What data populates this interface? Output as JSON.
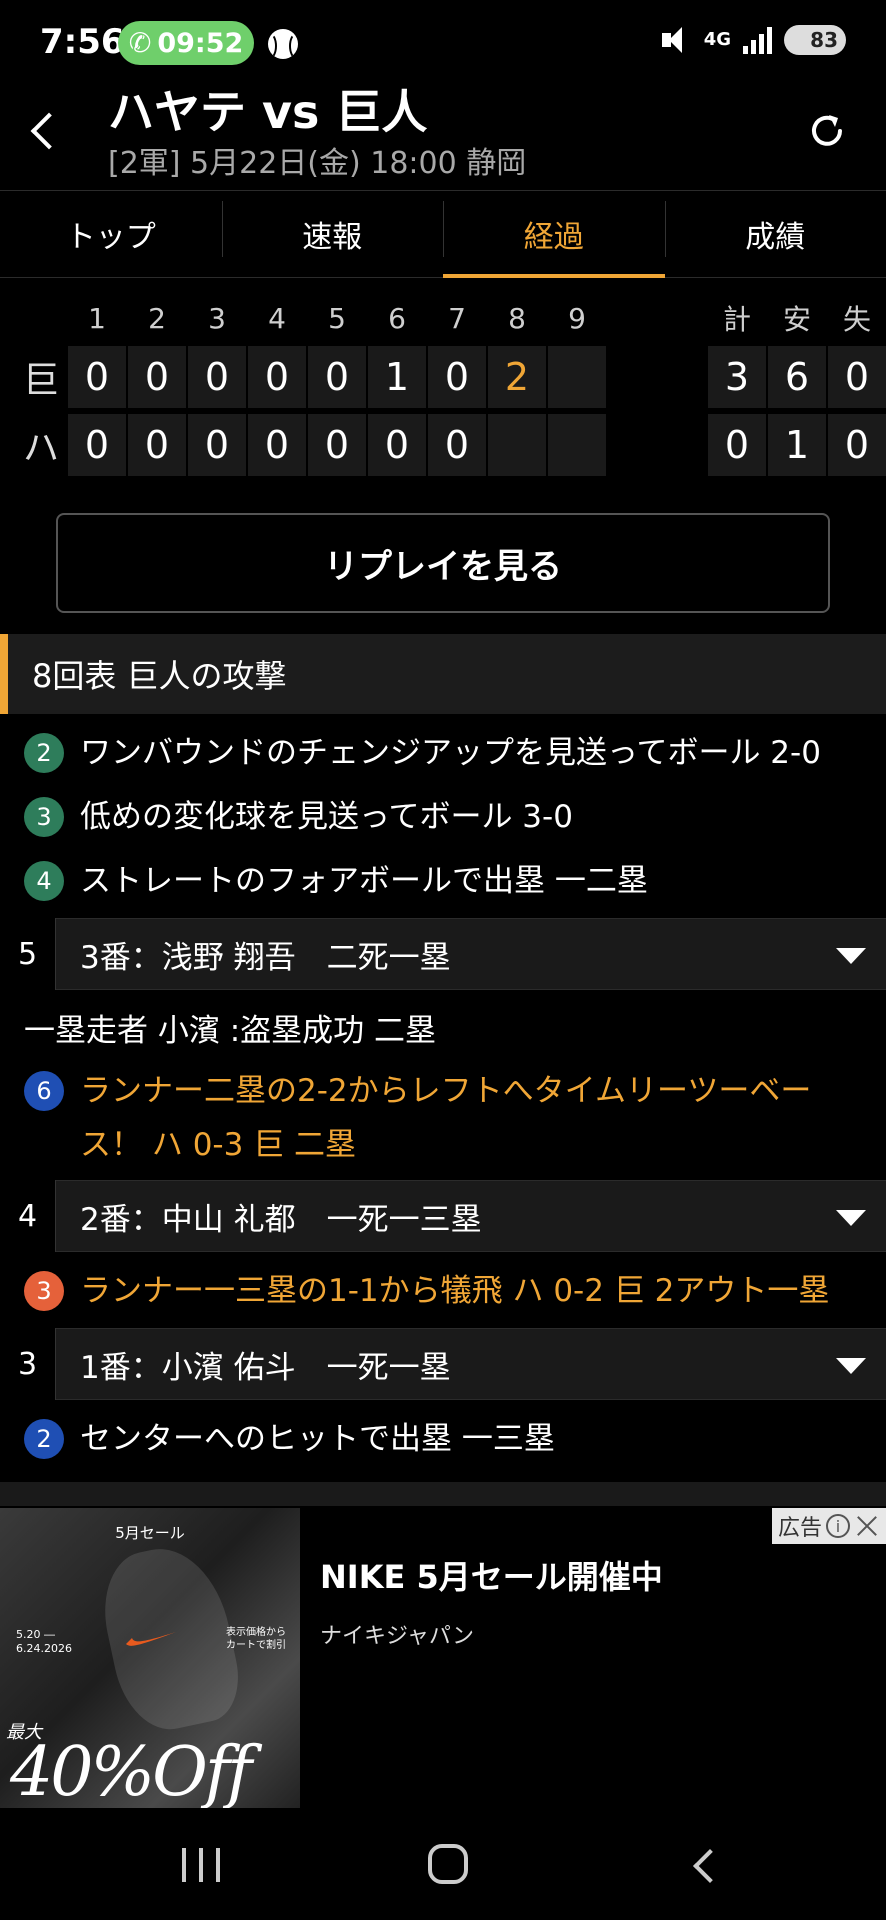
{
  "status_bar": {
    "time": "7:56",
    "call_time": "09:52",
    "network": "4G",
    "battery": "83"
  },
  "header": {
    "title": "ハヤテ vs 巨人",
    "subtitle": "[2軍] 5月22日(金) 18:00 静岡"
  },
  "tabs": [
    {
      "label": "トップ",
      "active": false
    },
    {
      "label": "速報",
      "active": false
    },
    {
      "label": "経過",
      "active": true
    },
    {
      "label": "成績",
      "active": false
    }
  ],
  "scoreboard": {
    "innings": [
      "1",
      "2",
      "3",
      "4",
      "5",
      "6",
      "7",
      "8",
      "9"
    ],
    "totals_headers": [
      "計",
      "安",
      "失"
    ],
    "teams": [
      {
        "name": "巨",
        "scores": [
          "0",
          "0",
          "0",
          "0",
          "0",
          "1",
          "0",
          "2",
          ""
        ],
        "totals": [
          "3",
          "6",
          "0"
        ]
      },
      {
        "name": "ハ",
        "scores": [
          "0",
          "0",
          "0",
          "0",
          "0",
          "0",
          "0",
          "",
          ""
        ],
        "totals": [
          "0",
          "1",
          "0"
        ]
      }
    ]
  },
  "replay_button": "リプレイを見る",
  "section": {
    "title": "8回表 巨人の攻撃"
  },
  "plays": {
    "p1": {
      "num": "2",
      "text": "ワンバウンドのチェンジアップを見送ってボール 2-0"
    },
    "p2": {
      "num": "3",
      "text": "低めの変化球を見送ってボール 3-0"
    },
    "p3": {
      "num": "4",
      "text": "ストレートのフォアボールで出塁 一二塁"
    },
    "batter5": {
      "order": "5",
      "label": "3番：浅野 翔吾　二死一塁"
    },
    "runner_note": "一塁走者 小濱 :盗塁成功 二塁",
    "p4": {
      "num": "6",
      "text": "ランナー二塁の2-2からレフトへタイムリーツーベース！ ハ 0-3 巨 二塁"
    },
    "batter4": {
      "order": "4",
      "label": "2番：中山 礼都　一死一三塁"
    },
    "p5": {
      "num": "3",
      "text": "ランナー一三塁の1-1から犠飛 ハ 0-2 巨 2アウト一塁"
    },
    "batter3": {
      "order": "3",
      "label": "1番：小濱 佑斗　一死一塁"
    },
    "p6": {
      "num": "2",
      "text": "センターへのヒットで出塁 一三塁"
    }
  },
  "ad": {
    "label": "広告",
    "title": "NIKE 5月セール開催中",
    "advertiser": "ナイキジャパン",
    "image_sale": "5月セール",
    "image_dates": "5.20 ―\n6.24.2026",
    "image_note": "表示価格から\nカートで割引",
    "image_max": "最大",
    "image_off": "40%Off"
  },
  "colors": {
    "accent": "#f0a636",
    "green_badge": "#2e7d5b",
    "blue_badge": "#1f4fb4",
    "orange_badge": "#e5613a",
    "call_pill": "#6fcf6b"
  }
}
